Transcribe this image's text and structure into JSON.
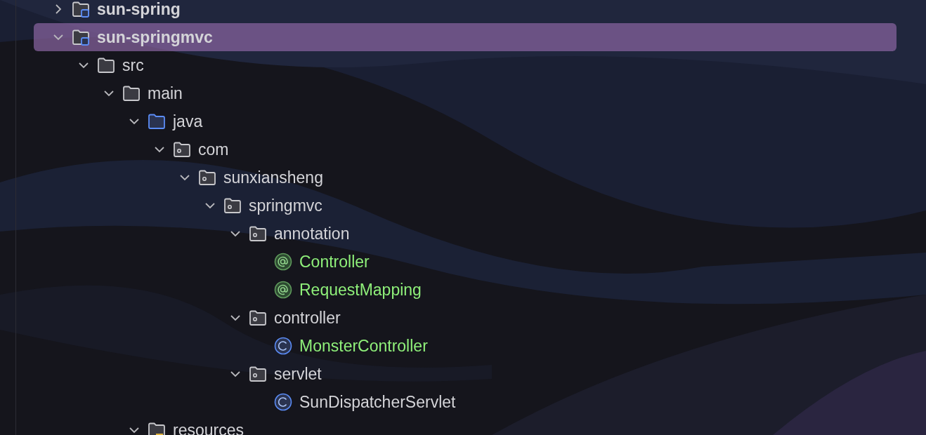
{
  "tree": [
    {
      "label": "sun-spring",
      "kind": "module",
      "expanded": false,
      "selected": false,
      "added": false
    },
    {
      "label": "sun-springmvc",
      "kind": "module",
      "expanded": true,
      "selected": true,
      "added": false,
      "children": [
        {
          "label": "src",
          "kind": "folder",
          "expanded": true,
          "selected": false,
          "added": false,
          "children": [
            {
              "label": "main",
              "kind": "folder",
              "expanded": true,
              "selected": false,
              "added": false,
              "children": [
                {
                  "label": "java",
                  "kind": "source",
                  "expanded": true,
                  "selected": false,
                  "added": false,
                  "children": [
                    {
                      "label": "com",
                      "kind": "package",
                      "expanded": true,
                      "selected": false,
                      "added": false,
                      "children": [
                        {
                          "label": "sunxiansheng",
                          "kind": "package",
                          "expanded": true,
                          "selected": false,
                          "added": false,
                          "children": [
                            {
                              "label": "springmvc",
                              "kind": "package",
                              "expanded": true,
                              "selected": false,
                              "added": false,
                              "children": [
                                {
                                  "label": "annotation",
                                  "kind": "package",
                                  "expanded": true,
                                  "selected": false,
                                  "added": false,
                                  "children": [
                                    {
                                      "label": "Controller",
                                      "kind": "annotation",
                                      "selected": false,
                                      "added": true
                                    },
                                    {
                                      "label": "RequestMapping",
                                      "kind": "annotation",
                                      "selected": false,
                                      "added": true
                                    }
                                  ]
                                },
                                {
                                  "label": "controller",
                                  "kind": "package",
                                  "expanded": true,
                                  "selected": false,
                                  "added": false,
                                  "children": [
                                    {
                                      "label": "MonsterController",
                                      "kind": "class",
                                      "selected": false,
                                      "added": true
                                    }
                                  ]
                                },
                                {
                                  "label": "servlet",
                                  "kind": "package",
                                  "expanded": true,
                                  "selected": false,
                                  "added": false,
                                  "children": [
                                    {
                                      "label": "SunDispatcherServlet",
                                      "kind": "class",
                                      "selected": false,
                                      "added": false
                                    }
                                  ]
                                }
                              ]
                            }
                          ]
                        }
                      ]
                    }
                  ]
                },
                {
                  "label": "resources",
                  "kind": "resources",
                  "expanded": true,
                  "selected": false,
                  "added": false
                }
              ]
            }
          ]
        }
      ]
    }
  ]
}
